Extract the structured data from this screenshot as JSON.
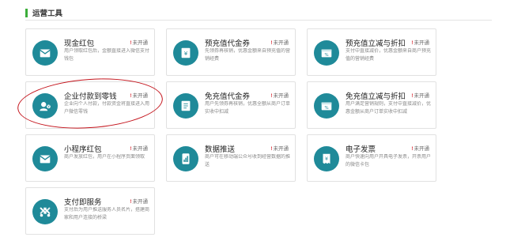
{
  "section": {
    "title": "运营工具"
  },
  "accent_color": "#1f8a99",
  "status_color": "#d8323a",
  "annotation_color": "#c4141c",
  "cards": [
    {
      "title": "现金红包",
      "status_mark": "!",
      "status": "未开通",
      "desc": "用户领取红包后，金额直接进入微信支付钱包",
      "icon": "red-envelope-icon"
    },
    {
      "title": "预充值代金券",
      "status_mark": "!",
      "status": "未开通",
      "desc": "先领券再核销，优惠金额来自预充值的营销经费",
      "icon": "coupon-icon"
    },
    {
      "title": "预充值立减与折扣",
      "status_mark": "!",
      "status": "未开通",
      "desc": "支付中直接减价，优惠金额来自商户预充值的营销经费",
      "icon": "discount-icon"
    },
    {
      "title": "企业付款到零钱",
      "status_mark": "!",
      "status": "未开通",
      "desc": "企业向个人付款，付款资金将直接进入用户微信零钱",
      "icon": "payment-to-wallet-icon"
    },
    {
      "title": "免充值代金券",
      "status_mark": "!",
      "status": "未开通",
      "desc": "用户先领券再核销，优惠全额从商户订单实收中扣减",
      "icon": "coupon-icon"
    },
    {
      "title": "免充值立减与折扣",
      "status_mark": "!",
      "status": "未开通",
      "desc": "用户满足营销规则，支付中直接减价，优惠金额从商户订单实收中扣减",
      "icon": "discount-icon"
    },
    {
      "title": "小程序红包",
      "status_mark": "!",
      "status": "未开通",
      "desc": "商户发放红包，用户在小程序页面领取",
      "icon": "mini-program-envelope-icon"
    },
    {
      "title": "数据推送",
      "status_mark": "!",
      "status": "未开通",
      "desc": "商户可在移动端公众号收到经营数据的推送",
      "icon": "data-push-icon"
    },
    {
      "title": "电子发票",
      "status_mark": "!",
      "status": "未开通",
      "desc": "商户快速向用户开具电子发票，开票用户的微信卡包",
      "icon": "invoice-icon"
    },
    {
      "title": "支付即服务",
      "status_mark": "!",
      "status": "未开通",
      "desc": "支付后为用户推送服务人员名片，搭建商家和用户连接的桥梁",
      "icon": "service-icon"
    }
  ]
}
